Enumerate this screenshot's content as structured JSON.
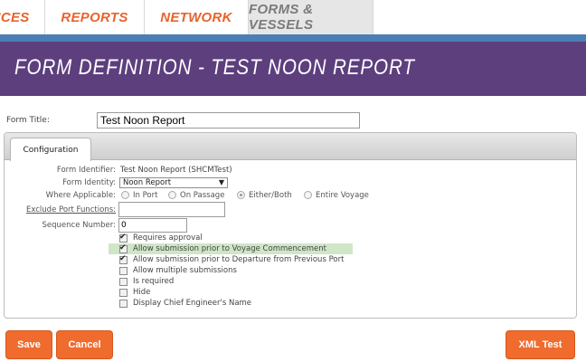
{
  "nav": {
    "tabs": [
      {
        "label": "ICES"
      },
      {
        "label": "REPORTS"
      },
      {
        "label": "NETWORK"
      },
      {
        "label": "FORMS & VESSELS"
      }
    ]
  },
  "banner": {
    "title": "FORM DEFINITION - TEST NOON REPORT"
  },
  "form_title": {
    "label": "Form Title:",
    "value": "Test Noon Report"
  },
  "panel": {
    "tab_label": "Configuration",
    "form_identifier": {
      "label": "Form Identifier:",
      "value": "Test Noon Report (SHCMTest)"
    },
    "form_identity": {
      "label": "Form Identity:",
      "selected": "Noon Report"
    },
    "where_applicable": {
      "label": "Where Applicable:",
      "options": [
        "In Port",
        "On Passage",
        "Either/Both",
        "Entire Voyage"
      ],
      "selected": "Either/Both"
    },
    "exclude_port_functions": {
      "label": "Exclude Port Functions:",
      "value": ""
    },
    "sequence_number": {
      "label": "Sequence Number:",
      "value": "0"
    },
    "checkboxes": [
      {
        "label": "Requires approval",
        "checked": true
      },
      {
        "label": "Allow submission prior to Voyage Commencement",
        "checked": true
      },
      {
        "label": "Allow submission prior to Departure from Previous Port",
        "checked": true
      },
      {
        "label": "Allow multiple submissions",
        "checked": false
      },
      {
        "label": "Is required",
        "checked": false
      },
      {
        "label": "Hide",
        "checked": false
      },
      {
        "label": "Display Chief Engineer's Name",
        "checked": false
      }
    ]
  },
  "buttons": {
    "save": "Save",
    "cancel": "Cancel",
    "xml_test": "XML Test"
  },
  "colors": {
    "accent": "#ef6c2e",
    "banner": "#5d3f7e",
    "nav_line": "#4a7fb3",
    "highlight": "#cfe6c7"
  }
}
